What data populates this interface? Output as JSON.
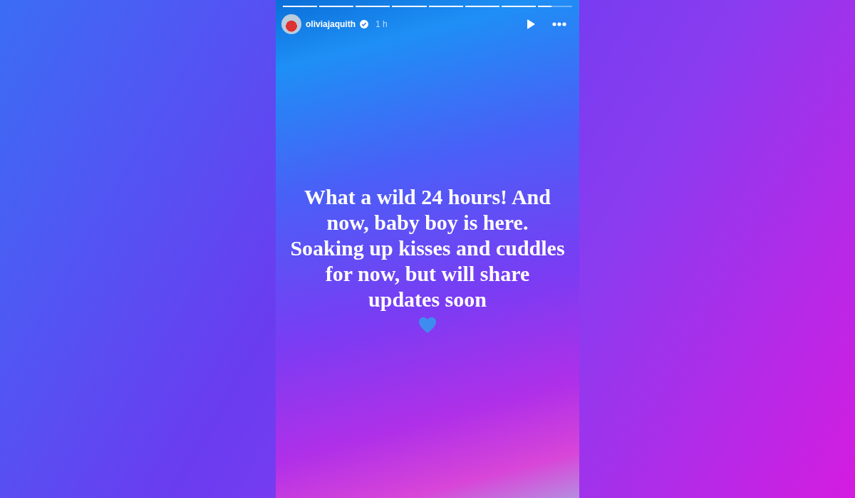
{
  "story": {
    "progress": [
      {
        "level": 1
      },
      {
        "level": 1
      },
      {
        "level": 1
      },
      {
        "level": 1
      },
      {
        "level": 1
      },
      {
        "level": 1
      },
      {
        "level": 1
      },
      {
        "level": 0.4
      }
    ],
    "username": "oliviajaquith",
    "verified": true,
    "time": "1 h",
    "text": "What a wild 24 hours! And now, baby boy is here. Soaking up kisses and cuddles for now, but will share updates soon"
  }
}
